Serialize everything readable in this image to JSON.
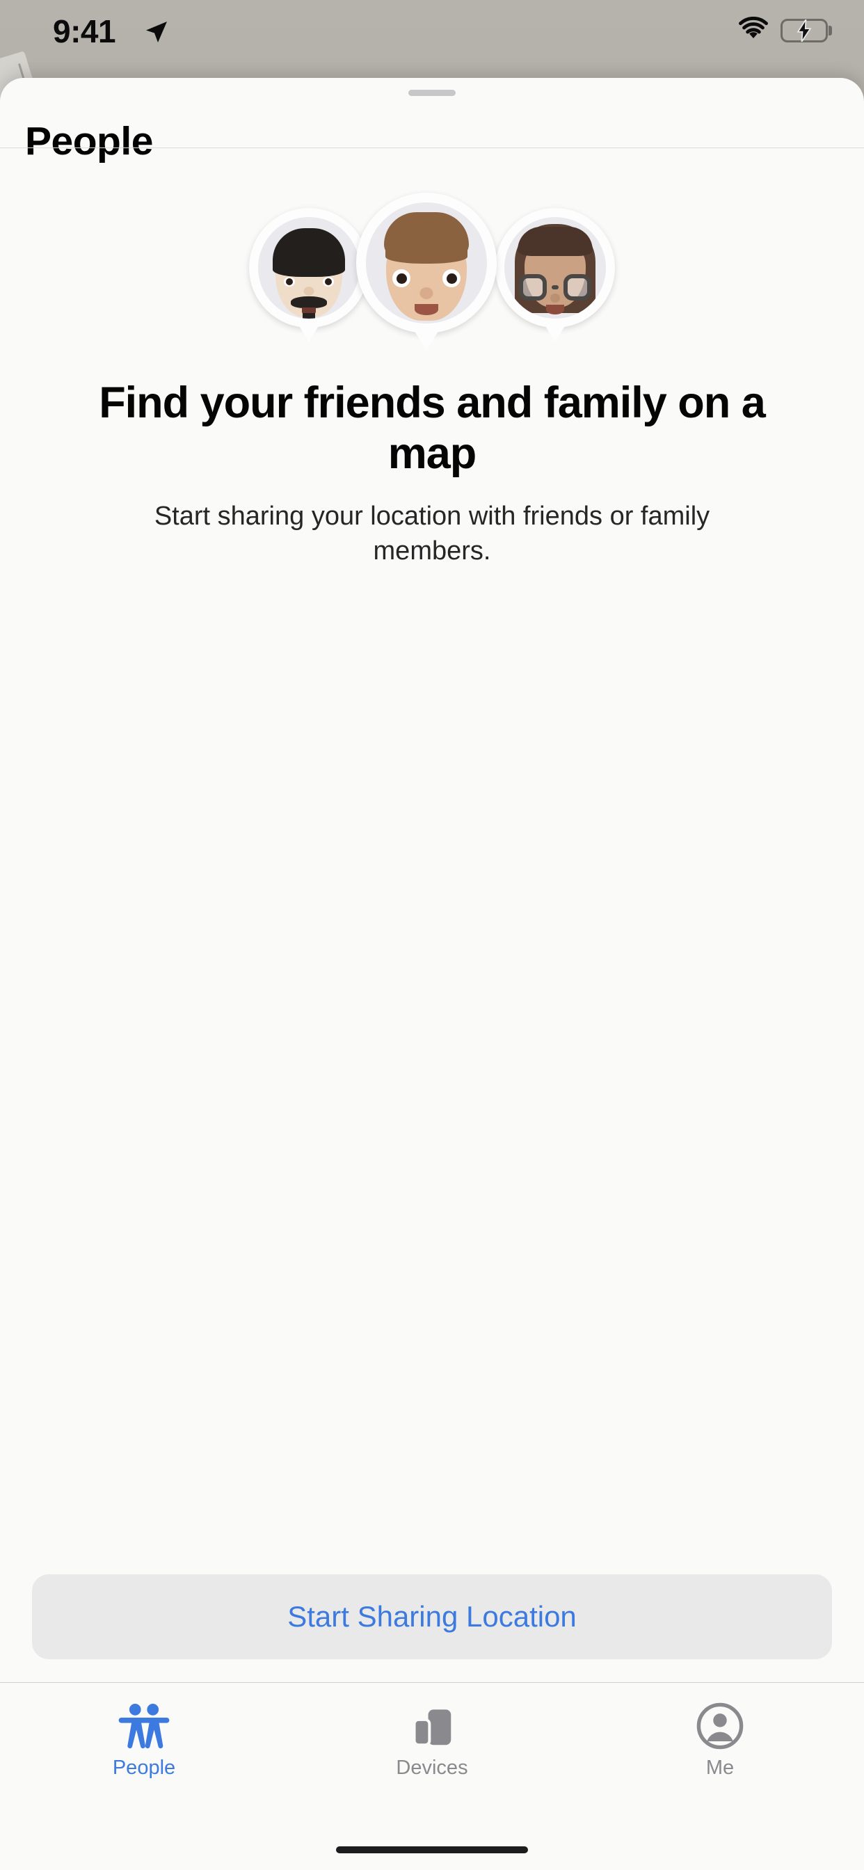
{
  "status_bar": {
    "time": "9:41",
    "location_icon": "location-arrow-icon",
    "wifi_icon": "wifi-icon",
    "battery_icon": "battery-charging-icon",
    "battery_color": "#3ad14e"
  },
  "sheet": {
    "grabber": "sheet-grabber",
    "title": "People"
  },
  "hero": {
    "illustration_name": "memoji-pins-illustration",
    "avatars": [
      {
        "name": "memoji-pin-left",
        "description": "Memoji with black bowl-cut hair and mustache"
      },
      {
        "name": "memoji-pin-center",
        "description": "Memoji with brown spiky hair and wide eyes"
      },
      {
        "name": "memoji-pin-right",
        "description": "Memoji with long brown hair, bangs and dark glasses"
      }
    ],
    "headline": "Find your friends and family on a map",
    "subhead": "Start sharing your location with friends or family members."
  },
  "cta": {
    "label": "Start Sharing Location",
    "text_color": "#3c7ae0",
    "background": "#e9e9e9"
  },
  "tabbar": {
    "active_color": "#3c7ae0",
    "inactive_color": "#8a8a8e",
    "tabs": [
      {
        "label": "People",
        "icon": "two-people-icon",
        "active": true
      },
      {
        "label": "Devices",
        "icon": "devices-icon",
        "active": false
      },
      {
        "label": "Me",
        "icon": "person-circle-icon",
        "active": false
      }
    ]
  },
  "home_indicator": "home-indicator"
}
